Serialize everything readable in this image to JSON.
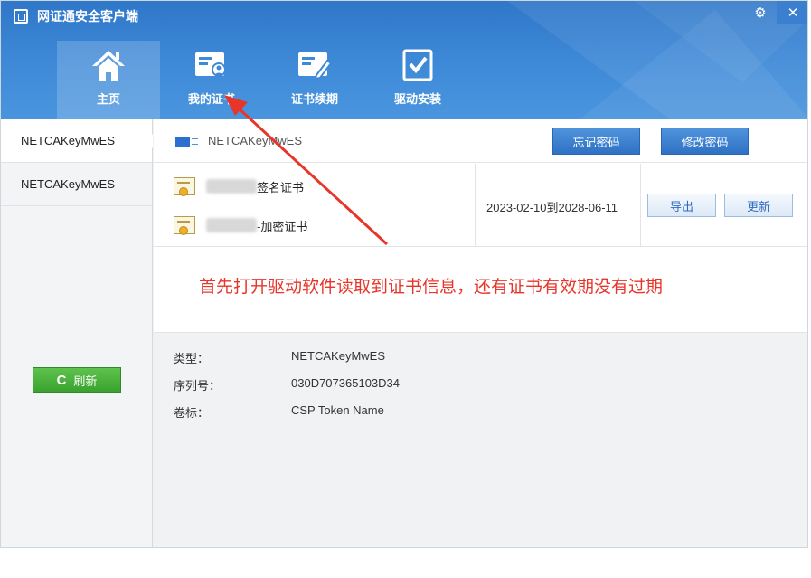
{
  "app": {
    "title": "网证通安全客户端"
  },
  "window_controls": {
    "settings": "⚙",
    "close": "✕"
  },
  "nav": [
    {
      "label": "主页",
      "icon": "home-icon"
    },
    {
      "label": "我的证书",
      "icon": "certificate-card-icon"
    },
    {
      "label": "证书续期",
      "icon": "certificate-renew-icon"
    },
    {
      "label": "驱动安装",
      "icon": "driver-install-icon"
    }
  ],
  "sidebar": {
    "items": [
      {
        "label": "NETCAKeyMwES"
      },
      {
        "label": "NETCAKeyMwES"
      }
    ],
    "refresh_label": "刷新"
  },
  "key_bar": {
    "name": "NETCAKeyMwES",
    "forgot_password": "忘记密码",
    "change_password": "修改密码"
  },
  "certificates": [
    {
      "name_suffix": "签名证书",
      "icon": "certificate-icon"
    },
    {
      "name_suffix": "-加密证书",
      "icon": "certificate-icon"
    }
  ],
  "validity": "2023-02-10到2028-06-11",
  "cert_actions": {
    "export": "导出",
    "renew": "更新"
  },
  "annotation": "首先打开驱动软件读取到证书信息，还有证书有效期没有过期",
  "details": [
    {
      "key": "类型：",
      "value": "NETCAKeyMwES"
    },
    {
      "key": "序列号：",
      "value": "030D707365103D34"
    },
    {
      "key": "卷标：",
      "value": "CSP Token Name"
    }
  ],
  "colors": {
    "header": "#3f8ad8",
    "accent_red": "#e8352a",
    "refresh_green": "#3aa22f"
  }
}
